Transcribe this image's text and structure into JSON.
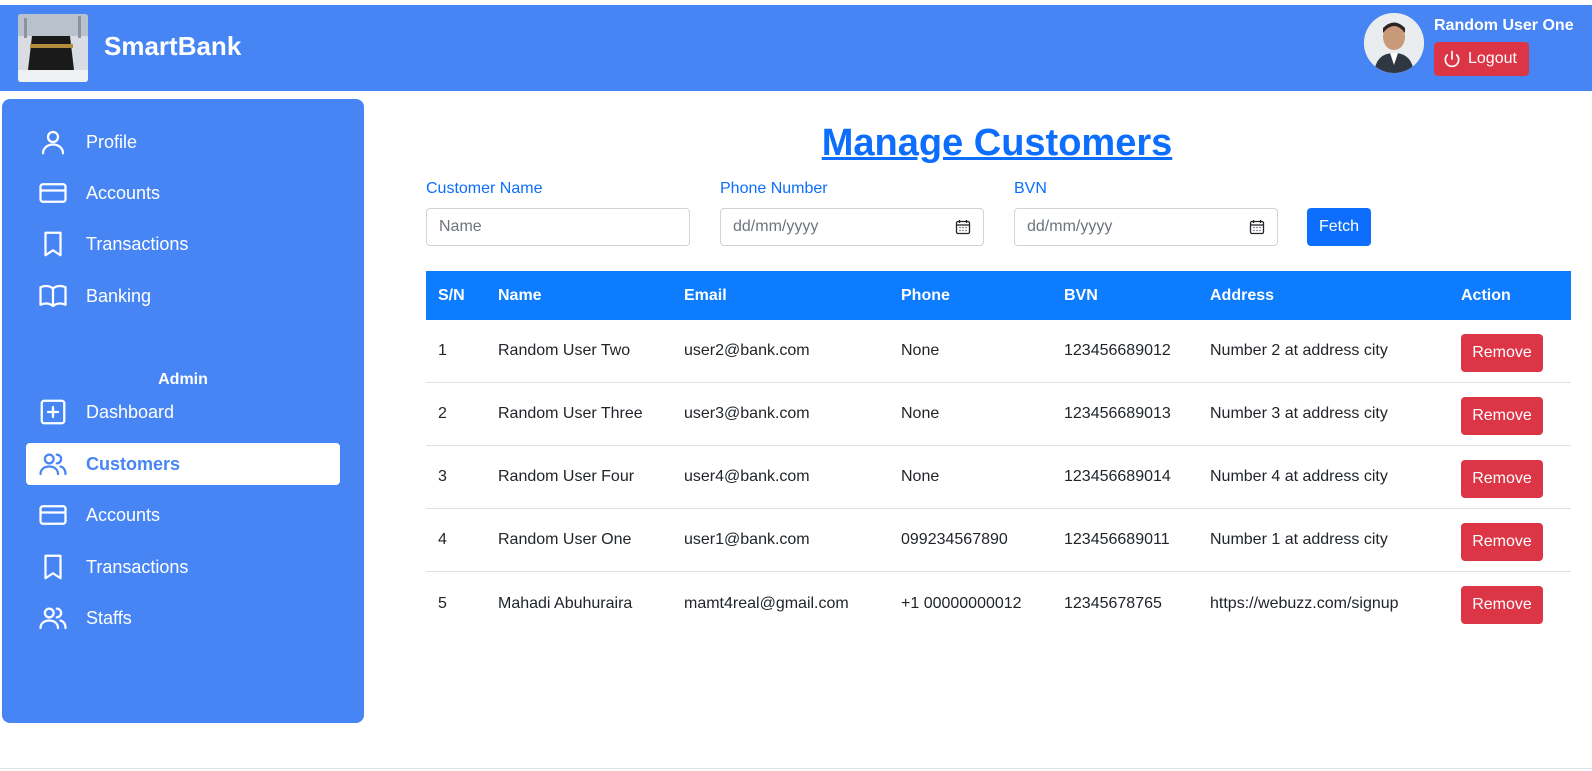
{
  "header": {
    "brand": "SmartBank",
    "user_name": "Random User One",
    "logout_label": "Logout",
    "colors": {
      "bar": "#4785f5",
      "logout": "#dc3545"
    }
  },
  "sidebar": {
    "main_items": [
      {
        "label": "Profile",
        "icon": "person-icon"
      },
      {
        "label": "Accounts",
        "icon": "credit-card-icon"
      },
      {
        "label": "Transactions",
        "icon": "bookmark-icon"
      },
      {
        "label": "Banking",
        "icon": "book-icon"
      }
    ],
    "admin_heading": "Admin",
    "admin_items": [
      {
        "label": "Dashboard",
        "icon": "plus-square-icon"
      },
      {
        "label": "Customers",
        "icon": "people-icon",
        "active": true
      },
      {
        "label": "Accounts",
        "icon": "credit-card-icon"
      },
      {
        "label": "Transactions",
        "icon": "bookmark-icon"
      },
      {
        "label": "Staffs",
        "icon": "people-icon"
      }
    ]
  },
  "main": {
    "title": "Manage Customers",
    "filters": {
      "name_label": "Customer Name",
      "name_placeholder": "Name",
      "phone_label": "Phone Number",
      "phone_placeholder": "dd/mm/yyyy",
      "bvn_label": "BVN",
      "bvn_placeholder": "dd/mm/yyyy",
      "fetch_label": "Fetch"
    },
    "table": {
      "headers": [
        "S/N",
        "Name",
        "Email",
        "Phone",
        "BVN",
        "Address",
        "Action"
      ],
      "rows": [
        {
          "sn": "1",
          "name": "Random User Two",
          "email": "user2@bank.com",
          "phone": "None",
          "bvn": "123456689012",
          "address": "Number 2 at address city",
          "action": "Remove"
        },
        {
          "sn": "2",
          "name": "Random User Three",
          "email": "user3@bank.com",
          "phone": "None",
          "bvn": "123456689013",
          "address": "Number 3 at address city",
          "action": "Remove"
        },
        {
          "sn": "3",
          "name": "Random User Four",
          "email": "user4@bank.com",
          "phone": "None",
          "bvn": "123456689014",
          "address": "Number 4 at address city",
          "action": "Remove"
        },
        {
          "sn": "4",
          "name": "Random User One",
          "email": "user1@bank.com",
          "phone": "099234567890",
          "bvn": "123456689011",
          "address": "Number 1 at address city",
          "action": "Remove"
        },
        {
          "sn": "5",
          "name": "Mahadi Abuhuraira",
          "email": "mamt4real@gmail.com",
          "phone": "+1 00000000012",
          "bvn": "12345678765",
          "address": "https://webuzz.com/signup",
          "action": "Remove"
        }
      ]
    }
  }
}
